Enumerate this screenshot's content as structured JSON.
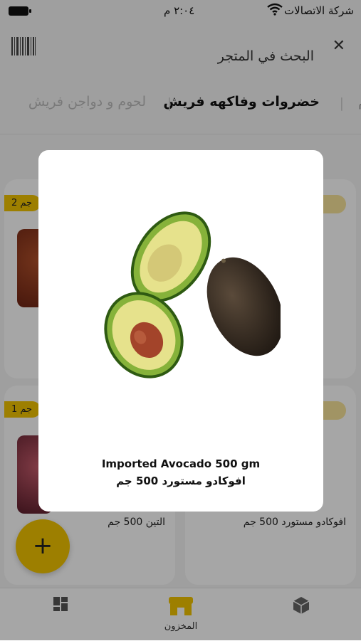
{
  "status_bar": {
    "time": "٢:٠٤ م",
    "carrier": "شركة الاتصالات"
  },
  "search": {
    "placeholder": "البحث في المتجر"
  },
  "tabs": [
    {
      "label": "م"
    },
    {
      "label": "خضروات وفاكهه فريش"
    },
    {
      "label": "لحوم و دواجن فريش"
    }
  ],
  "products": [
    {
      "name": "",
      "weight": "2 جم"
    },
    {
      "name": "",
      "weight": ""
    },
    {
      "name": "التين 500 جم",
      "weight": "1 جم"
    },
    {
      "name": "افوكادو مستورد 500 جم",
      "weight": ""
    }
  ],
  "fab": {
    "label": "+"
  },
  "bottom_nav": {
    "items": [
      {
        "label": "",
        "icon": "dashboard-icon"
      },
      {
        "label": "المخزون",
        "icon": "store-icon"
      },
      {
        "label": "",
        "icon": "box-icon"
      }
    ]
  },
  "modal": {
    "title_en": "Imported Avocado 500 gm",
    "title_ar": "افوكادو مستورد 500 جم"
  },
  "colors": {
    "accent": "#f2c400",
    "overlay": "rgba(0,0,0,0.35)"
  }
}
